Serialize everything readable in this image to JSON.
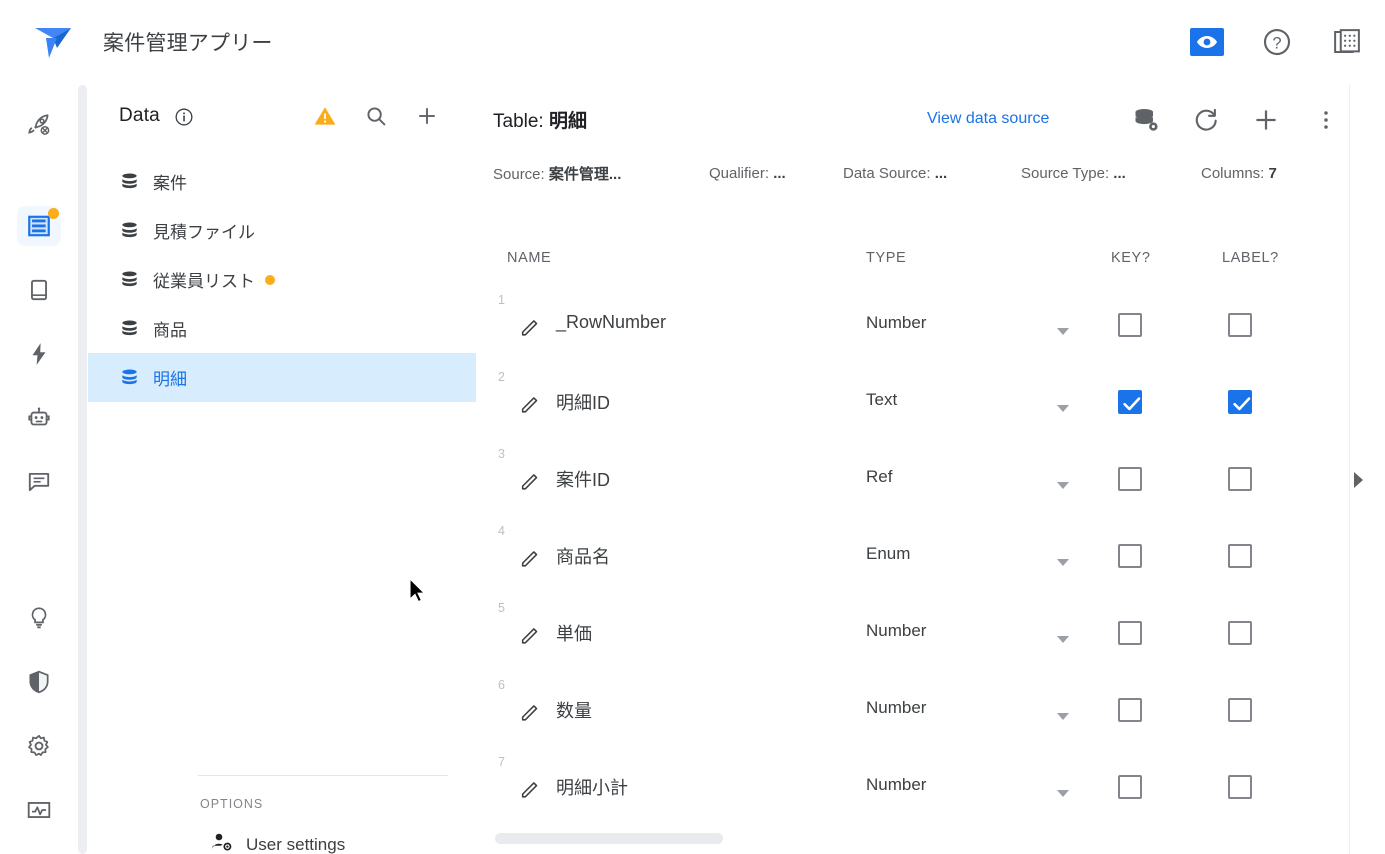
{
  "header": {
    "app_title": "案件管理アプリー",
    "logo_name": "appsheet-logo",
    "actions": [
      {
        "name": "preview-app-button",
        "icon": "eye-icon",
        "active": true
      },
      {
        "name": "help-button",
        "icon": "question-circle-icon",
        "active": false
      },
      {
        "name": "spreadsheet-button",
        "icon": "grid-table-icon",
        "active": false
      }
    ]
  },
  "rail": {
    "items": [
      {
        "name": "sidebar-item-deploy",
        "icon": "rocket-icon",
        "active": false,
        "badge": false
      },
      {
        "name": "sidebar-item-data",
        "icon": "data-table-icon",
        "active": true,
        "badge": true
      },
      {
        "name": "sidebar-item-app",
        "icon": "mobile-icon",
        "active": false,
        "badge": false
      },
      {
        "name": "sidebar-item-automation",
        "icon": "bolt-icon",
        "active": false,
        "badge": false
      },
      {
        "name": "sidebar-item-intelligence",
        "icon": "robot-icon",
        "active": false,
        "badge": false
      },
      {
        "name": "sidebar-item-chat",
        "icon": "comment-icon",
        "active": false,
        "badge": false
      },
      {
        "name": "sidebar-item-ideas",
        "icon": "lightbulb-icon",
        "active": false,
        "badge": false
      },
      {
        "name": "sidebar-item-security",
        "icon": "shield-icon",
        "active": false,
        "badge": false
      },
      {
        "name": "sidebar-item-settings",
        "icon": "gear-icon",
        "active": false,
        "badge": false
      },
      {
        "name": "sidebar-item-monitor",
        "icon": "monitor-chart-icon",
        "active": false,
        "badge": false
      }
    ]
  },
  "data_panel": {
    "title": "Data",
    "info_icon": "info-circle-icon",
    "actions": [
      {
        "name": "data-warning-button",
        "icon": "warning-triangle-icon"
      },
      {
        "name": "data-search-button",
        "icon": "search-icon"
      },
      {
        "name": "data-add-table-button",
        "icon": "plus-icon"
      }
    ],
    "tables": [
      {
        "label": "案件",
        "selected": false,
        "badge": false
      },
      {
        "label": "見積ファイル",
        "selected": false,
        "badge": false
      },
      {
        "label": "従業員リスト",
        "selected": false,
        "badge": true
      },
      {
        "label": "商品",
        "selected": false,
        "badge": false
      },
      {
        "label": "明細",
        "selected": true,
        "badge": false
      }
    ],
    "options_label": "OPTIONS",
    "options_chevron": "chevron-down-icon",
    "user_settings_label": "User settings",
    "user_settings_icon": "person-gear-icon"
  },
  "main": {
    "table_prefix": "Table:",
    "table_name": "明細",
    "view_data_source_label": "View data source",
    "actions": [
      {
        "name": "data-source-settings-button",
        "icon": "database-gear-icon"
      },
      {
        "name": "regenerate-button",
        "icon": "refresh-icon"
      },
      {
        "name": "add-column-button",
        "icon": "plus-icon"
      },
      {
        "name": "more-options-button",
        "icon": "kebab-menu-icon"
      }
    ],
    "meta": [
      {
        "label": "Source:",
        "value": "案件管理..."
      },
      {
        "label": "Qualifier:",
        "value": "..."
      },
      {
        "label": "Data Source:",
        "value": "..."
      },
      {
        "label": "Source Type:",
        "value": "..."
      },
      {
        "label": "Columns:",
        "value": "7"
      }
    ],
    "columns": [
      "NAME",
      "TYPE",
      "KEY?",
      "LABEL?"
    ],
    "rows": [
      {
        "num": "1",
        "name": "_RowNumber",
        "type": "Number",
        "key": false,
        "label": false
      },
      {
        "num": "2",
        "name": "明細ID",
        "type": "Text",
        "key": true,
        "label": true
      },
      {
        "num": "3",
        "name": "案件ID",
        "type": "Ref",
        "key": false,
        "label": false
      },
      {
        "num": "4",
        "name": "商品名",
        "type": "Enum",
        "key": false,
        "label": false
      },
      {
        "num": "5",
        "name": "単価",
        "type": "Number",
        "key": false,
        "label": false
      },
      {
        "num": "6",
        "name": "数量",
        "type": "Number",
        "key": false,
        "label": false
      },
      {
        "num": "7",
        "name": "明細小計",
        "type": "Number",
        "key": false,
        "label": false
      }
    ]
  },
  "right_panel_handle": {
    "name": "expand-right-panel-handle",
    "icon": "triangle-right-icon"
  },
  "colors": {
    "accent_blue": "#1a73e8",
    "selected_row_bg": "#d7ecfd",
    "warning_orange": "#fbad17",
    "text_primary": "#3c4043",
    "text_secondary": "#5f6368"
  }
}
